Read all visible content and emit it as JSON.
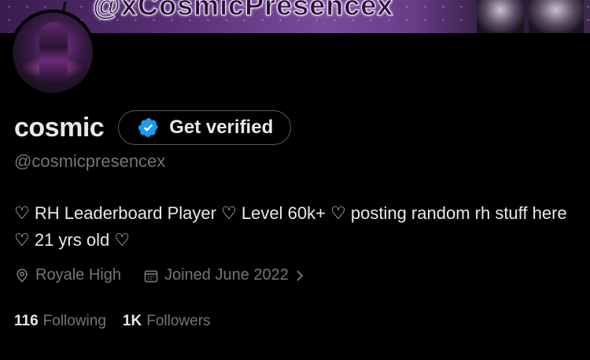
{
  "banner": {
    "text": "@xCosmicPresencex"
  },
  "profile": {
    "display_name": "cosmic",
    "verify_label": "Get verified",
    "handle": "@cosmicpresencex",
    "bio": "♡ RH Leaderboard Player ♡ Level 60k+ ♡ posting random rh stuff here ♡ 21 yrs old ♡",
    "location": "Royale High",
    "joined": "Joined June 2022"
  },
  "stats": {
    "following_count": "116",
    "following_label": "Following",
    "followers_count": "1K",
    "followers_label": "Followers"
  },
  "icons": {
    "verify": "verified-badge-icon",
    "location": "location-pin-icon",
    "calendar": "calendar-icon",
    "chevron": "chevron-right-icon"
  },
  "colors": {
    "background": "#000000",
    "primary_text": "#e7e9ea",
    "secondary_text": "#71767b",
    "verified_blue": "#1d9bf0",
    "banner_purple": "#5a2f78"
  }
}
